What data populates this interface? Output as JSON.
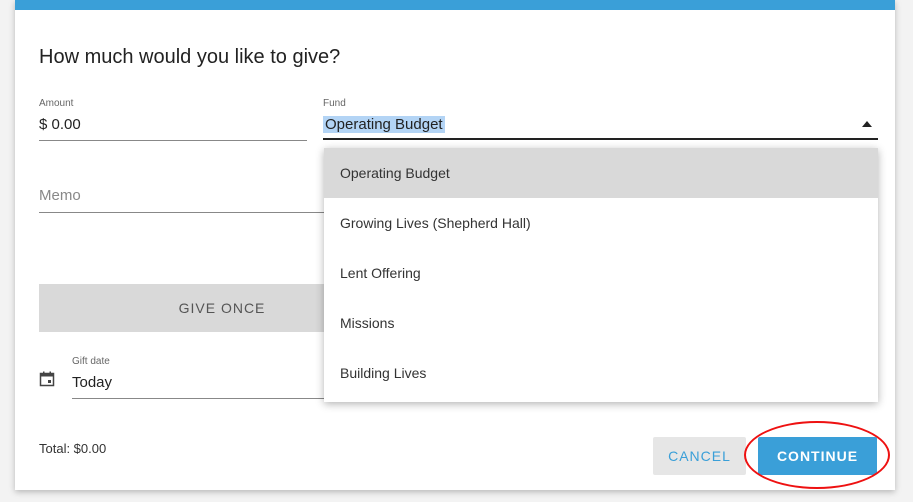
{
  "dialog": {
    "title": "How much would you like to give?",
    "amount": {
      "label": "Amount",
      "value": "$ 0.00"
    },
    "fund": {
      "label": "Fund",
      "value": "Operating Budget"
    },
    "memo": {
      "placeholder": "Memo"
    },
    "give_once_label": "GIVE ONCE",
    "gift_date": {
      "label": "Gift date",
      "value": "Today"
    },
    "total": "Total: $0.00",
    "cancel_label": "CANCEL",
    "continue_label": "CONTINUE"
  },
  "fund_options": [
    "Operating Budget",
    "Growing Lives (Shepherd Hall)",
    "Lent Offering",
    "Missions",
    "Building Lives"
  ],
  "colors": {
    "accent": "#3a9fd8",
    "highlight": "#b3d4f5",
    "annotation": "#ee1111"
  }
}
